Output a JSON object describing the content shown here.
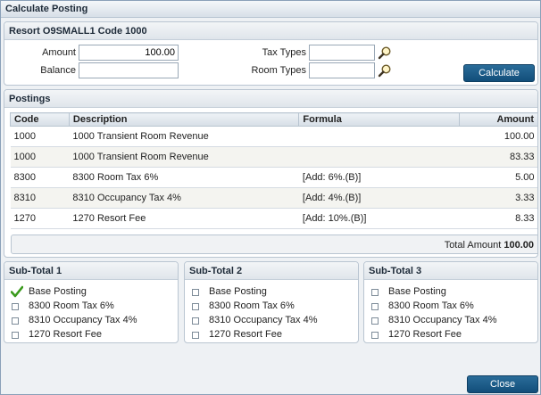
{
  "window": {
    "title": "Calculate Posting"
  },
  "resort": {
    "header": "Resort O9SMALL1 Code 1000",
    "amount_label": "Amount",
    "amount_value": "100.00",
    "balance_label": "Balance",
    "balance_value": "",
    "tax_types_label": "Tax Types",
    "tax_types_value": "",
    "room_types_label": "Room Types",
    "room_types_value": "",
    "calculate_label": "Calculate"
  },
  "postings": {
    "header": "Postings",
    "columns": [
      "Code",
      "Description",
      "Formula",
      "Amount"
    ],
    "rows": [
      {
        "code": "1000",
        "description": "1000 Transient Room Revenue",
        "formula": "",
        "amount": "100.00"
      },
      {
        "code": "1000",
        "description": "1000 Transient Room Revenue",
        "formula": "",
        "amount": "83.33"
      },
      {
        "code": "8300",
        "description": "8300 Room Tax 6%",
        "formula": "[Add: 6%.(B)]",
        "amount": "5.00"
      },
      {
        "code": "8310",
        "description": "8310 Occupancy Tax 4%",
        "formula": "[Add: 4%.(B)]",
        "amount": "3.33"
      },
      {
        "code": "1270",
        "description": "1270 Resort Fee",
        "formula": "[Add: 10%.(B)]",
        "amount": "8.33"
      }
    ],
    "total_label": "Total Amount",
    "total_value": "100.00"
  },
  "subtotals": [
    {
      "header": "Sub-Total 1",
      "items": [
        {
          "label": "Base Posting",
          "checked": true
        },
        {
          "label": "8300 Room Tax 6%",
          "checked": false
        },
        {
          "label": "8310 Occupancy Tax 4%",
          "checked": false
        },
        {
          "label": "1270 Resort Fee",
          "checked": false
        }
      ]
    },
    {
      "header": "Sub-Total 2",
      "items": [
        {
          "label": "Base Posting",
          "checked": false
        },
        {
          "label": "8300 Room Tax 6%",
          "checked": false
        },
        {
          "label": "8310 Occupancy Tax 4%",
          "checked": false
        },
        {
          "label": "1270 Resort Fee",
          "checked": false
        }
      ]
    },
    {
      "header": "Sub-Total 3",
      "items": [
        {
          "label": "Base Posting",
          "checked": false
        },
        {
          "label": "8300 Room Tax 6%",
          "checked": false
        },
        {
          "label": "8310 Occupancy Tax 4%",
          "checked": false
        },
        {
          "label": "1270 Resort Fee",
          "checked": false
        }
      ]
    }
  ],
  "footer": {
    "close_label": "Close"
  },
  "icons": {
    "search": "magnifier-icon",
    "check": "checkmark-icon"
  },
  "colors": {
    "button": "#17567f",
    "check": "#3a9a1c"
  }
}
